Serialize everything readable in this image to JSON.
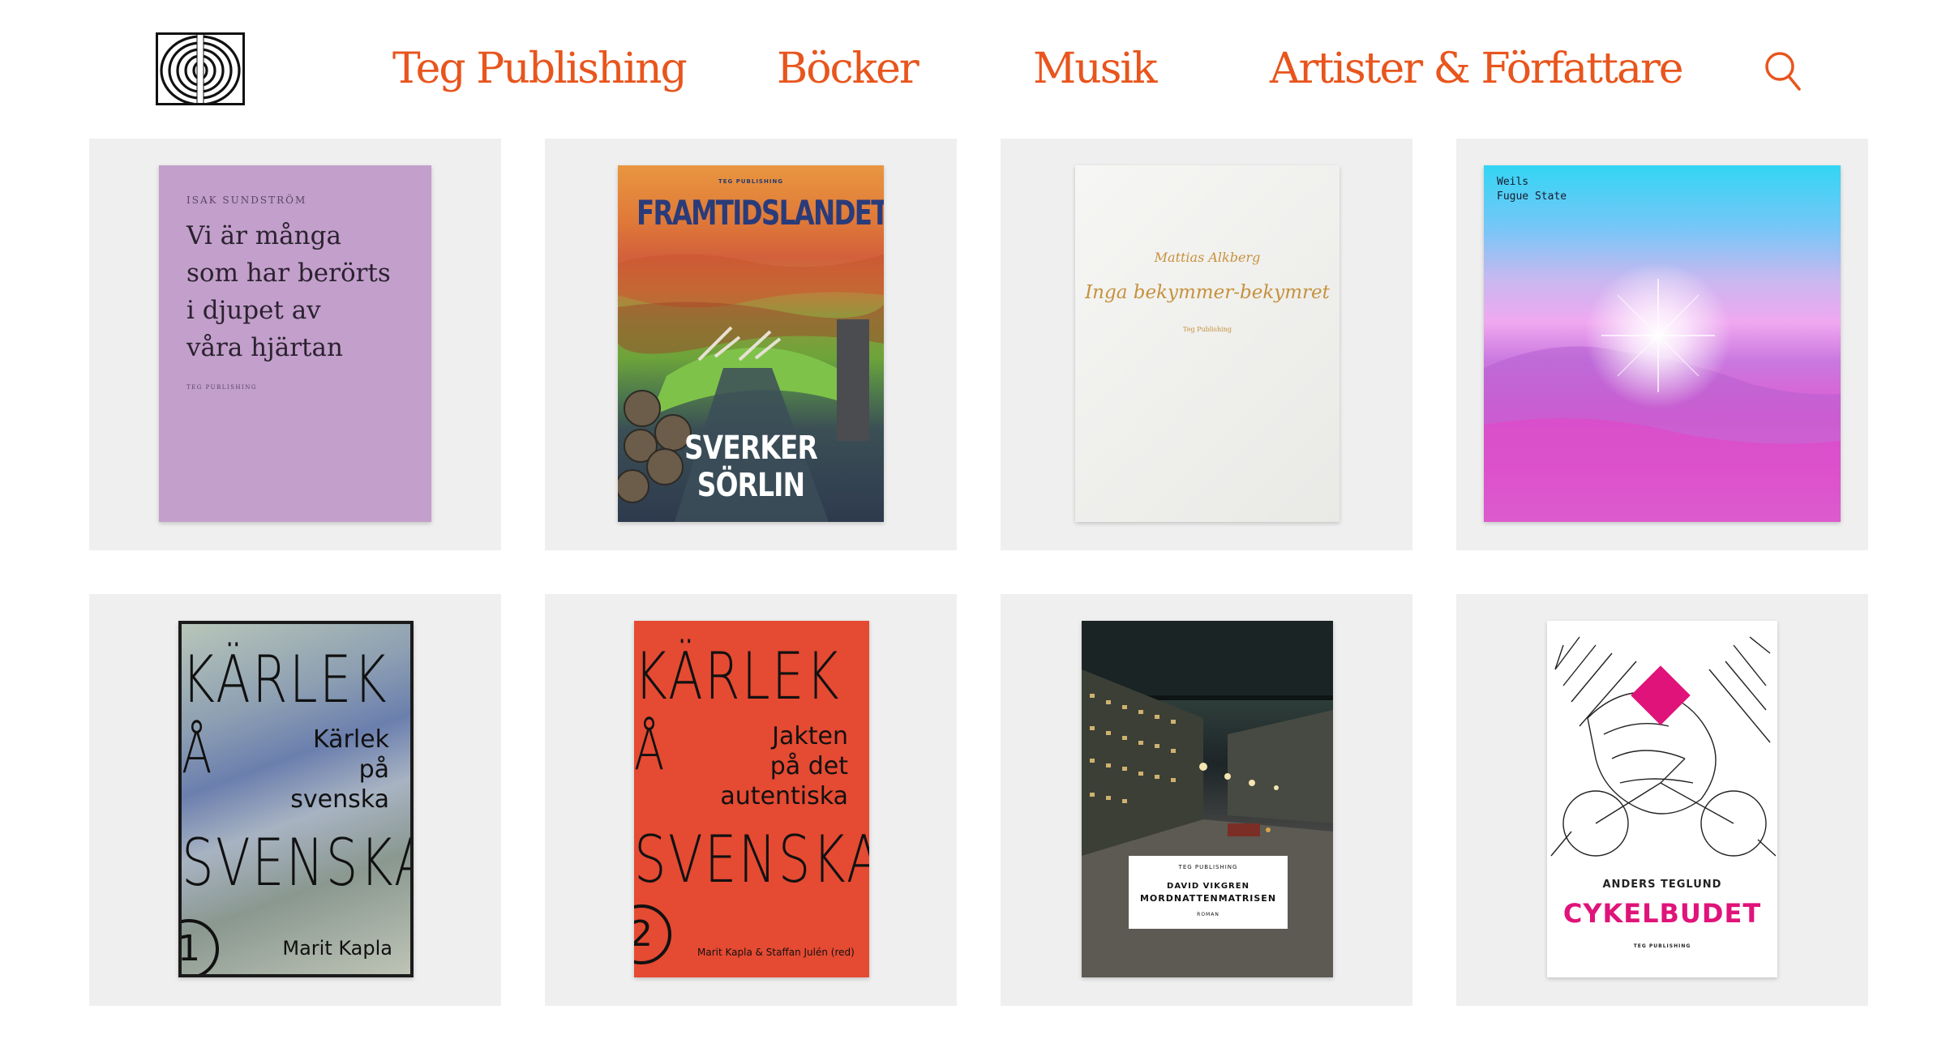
{
  "header": {
    "logo_icon": "concentric-arches-logo-icon",
    "nav": [
      "Teg Publishing",
      "Böcker",
      "Musik",
      "Artister & Författare"
    ],
    "search_icon": "search-icon",
    "accent_color": "#e8551d"
  },
  "items": [
    {
      "author": "ISAK SUNDSTRÖM",
      "title": "Vi är många\nsom har berörts\ni djupet av\nvåra hjärtan",
      "publisher": "TEG PUBLISHING"
    },
    {
      "publisher": "TEG PUBLISHING",
      "title": "FRAMTIDSLANDET",
      "author": "SVERKER SÖRLIN"
    },
    {
      "author": "Mattias Alkberg",
      "title": "Inga bekymmer-bekymret",
      "publisher": "Teg Publishing"
    },
    {
      "artist": "Weils",
      "title": "Fugue State"
    },
    {
      "series": "KÄRLEK",
      "series2": "SVENSKA",
      "series_glyph": "Å",
      "title": "Kärlek\npå\nsvenska",
      "author": "Marit Kapla",
      "number": "1"
    },
    {
      "series": "KÄRLEK",
      "series2": "SVENSKA",
      "series_glyph": "Å",
      "title": "Jakten\npå det\nautentiska",
      "author": "Marit Kapla & Staffan Julén (red)",
      "number": "2"
    },
    {
      "publisher": "TEG PUBLISHING",
      "author": "DAVID VIKGREN",
      "title": "MORDNATTENMATRISEN",
      "genre": "ROMAN"
    },
    {
      "author": "ANDERS TEGLUND",
      "title": "CYKELBUDET",
      "publisher": "TEG PUBLISHING"
    }
  ]
}
